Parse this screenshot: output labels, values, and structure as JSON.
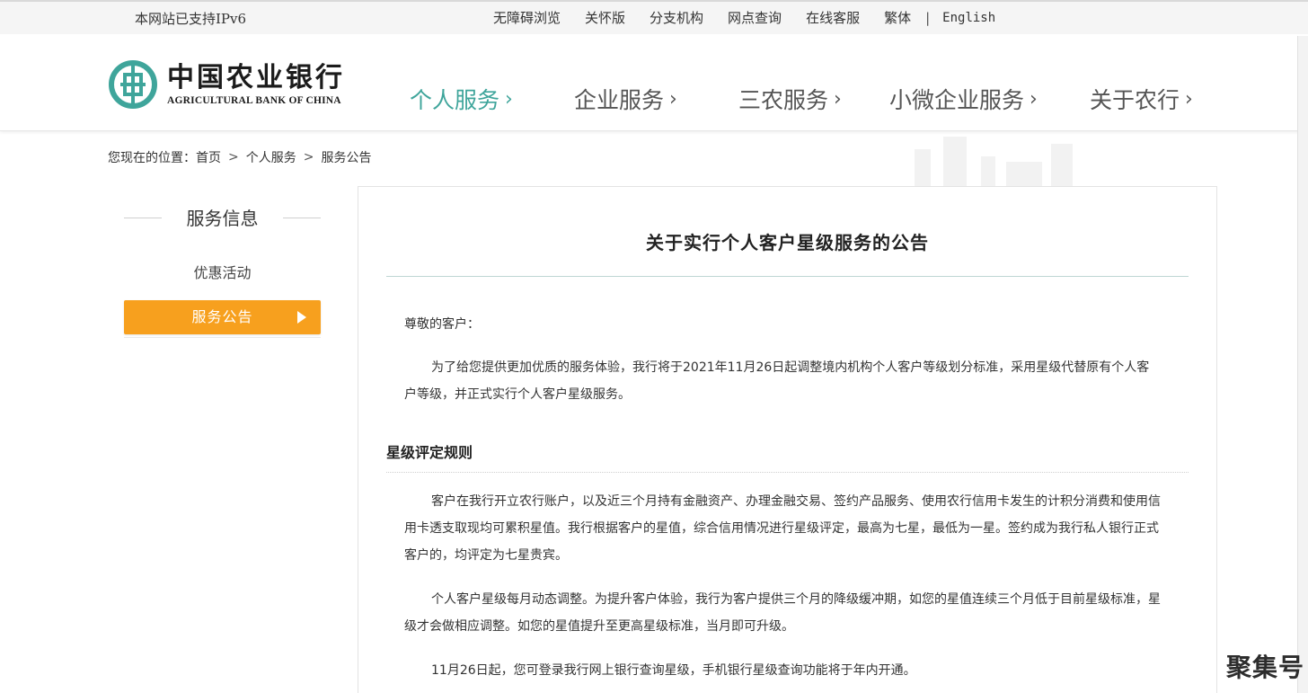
{
  "topbar": {
    "ipv6_notice": "本网站已支持IPv6",
    "links": {
      "accessibility": "无障碍浏览",
      "care_mode": "关怀版",
      "branches": "分支机构",
      "outlet_query": "网点查询",
      "online_service": "在线客服",
      "traditional": "繁体",
      "separator": "|",
      "english": "English"
    }
  },
  "logo": {
    "cn": "中国农业银行",
    "en": "AGRICULTURAL BANK OF CHINA",
    "emblem_color": "#3fa59b"
  },
  "nav": {
    "personal": "个人服务",
    "corporate": "企业服务",
    "sannong": "三农服务",
    "small_business": "小微企业服务",
    "about": "关于农行",
    "chevron": "›",
    "active_color": "#3fa59b"
  },
  "breadcrumb": {
    "prefix": "您现在的位置：",
    "home": "首页",
    "sep": ">",
    "level1": "个人服务",
    "level2": "服务公告"
  },
  "sidebar": {
    "title": "服务信息",
    "items": {
      "promotions": "优惠活动",
      "announcements": "服务公告"
    },
    "active_color": "#f7a01e"
  },
  "article": {
    "title": "关于实行个人客户星级服务的公告",
    "greeting": "尊敬的客户：",
    "intro": "为了给您提供更加优质的服务体验，我行将于2021年11月26日起调整境内机构个人客户等级划分标准，采用星级代替原有个人客户等级，并正式实行个人客户星级服务。",
    "section_heading": "星级评定规则",
    "p1": "客户在我行开立农行账户，以及近三个月持有金融资产、办理金融交易、签约产品服务、使用农行信用卡发生的计积分消费和使用信用卡透支取现均可累积星值。我行根据客户的星值，综合信用情况进行星级评定，最高为七星，最低为一星。签约成为我行私人银行正式客户的，均评定为七星贵宾。",
    "p2": "个人客户星级每月动态调整。为提升客户体验，我行为客户提供三个月的降级缓冲期，如您的星值连续三个月低于目前星级标准，星级才会做相应调整。如您的星值提升至更高星级标准，当月即可升级。",
    "p3": "11月26日起，您可登录我行网上银行查询星级，手机银行星级查询功能将于年内开通。"
  },
  "watermark": "聚集号"
}
